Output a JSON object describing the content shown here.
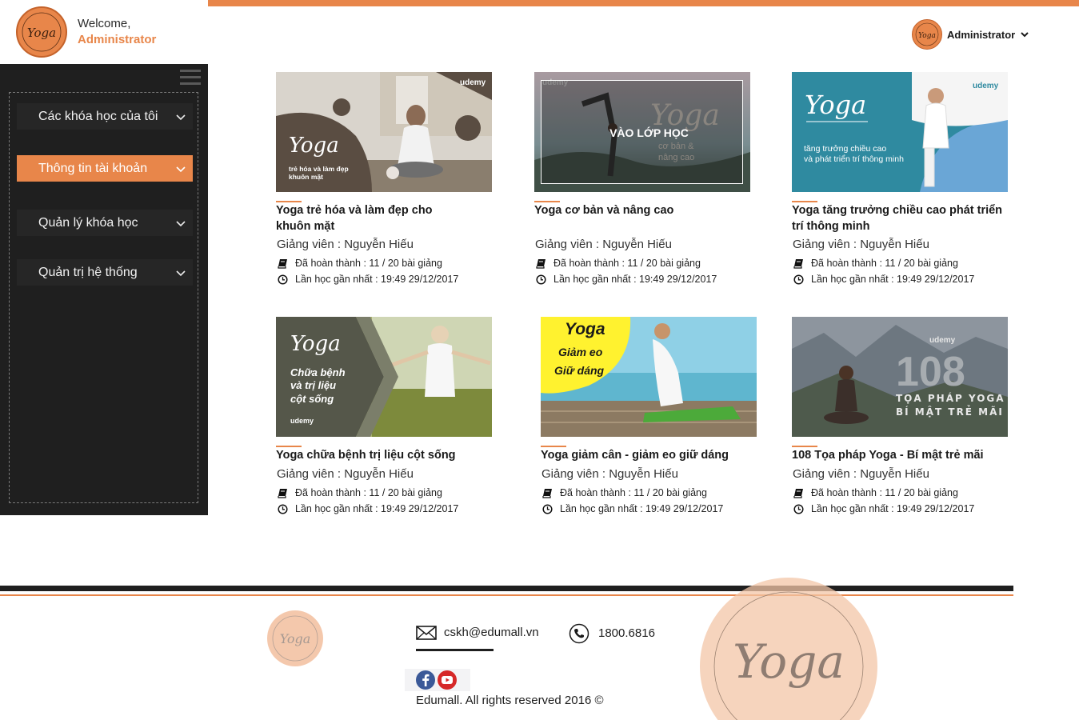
{
  "colors": {
    "accent": "#e8864a",
    "dark": "#1f1f1f",
    "logo_bg": "#f3c6a7"
  },
  "header": {
    "logo_text": "Yoga",
    "welcome": "Welcome,",
    "username": "Administrator",
    "user_menu": {
      "name": "Administrator",
      "caret_icon": "chevron-down-icon"
    }
  },
  "sidebar": {
    "menu_icon": "hamburger-icon",
    "items": [
      {
        "label": "Các khóa học của tôi",
        "active": false
      },
      {
        "label": "Thông tin tài khoản",
        "active": true
      },
      {
        "label": "Quản lý khóa học",
        "active": false
      },
      {
        "label": "Quản trị hệ thống",
        "active": false
      }
    ]
  },
  "courses": [
    {
      "title": "Yoga trẻ hóa và làm đẹp cho khuôn mặt",
      "instructor": "Giảng viên : Nguyễn Hiếu",
      "progress": "Đã hoàn thành : 11 / 20 bài giảng",
      "last_study": "Lần học gần nhất : 19:49 29/12/2017",
      "thumb": {
        "brand": "udemy",
        "heading": "Yoga",
        "sub1": "trẻ hóa và làm đẹp",
        "sub2": "khuôn mặt"
      }
    },
    {
      "title": "Yoga cơ bản và nâng cao",
      "instructor": "Giảng viên : Nguyễn Hiếu",
      "progress": "Đã hoàn thành : 11 / 20 bài giảng",
      "last_study": "Lần học gần nhất : 19:49 29/12/2017",
      "thumb": {
        "brand": "udemy",
        "heading": "Yoga",
        "sub1": "cơ bản &",
        "sub2": "nâng cao",
        "overlay": "VÀO LỚP HỌC"
      }
    },
    {
      "title": "Yoga tăng trưởng chiều cao phát triển trí thông minh",
      "instructor": "Giảng viên : Nguyễn Hiếu",
      "progress": "Đã hoàn thành : 11 / 20 bài giảng",
      "last_study": "Lần học gần nhất : 19:49 29/12/2017",
      "thumb": {
        "brand": "udemy",
        "heading": "Yoga",
        "sub1": "tăng trưởng chiều cao",
        "sub2": "và phát triển trí thông minh"
      }
    },
    {
      "title": "Yoga chữa bệnh trị liệu cột sống",
      "instructor": "Giảng viên : Nguyễn Hiếu",
      "progress": "Đã hoàn thành : 11 / 20 bài giảng",
      "last_study": "Lần học gần nhất : 19:49 29/12/2017",
      "thumb": {
        "brand": "udemy",
        "heading": "Yoga",
        "sub1": "Chữa bệnh",
        "sub2": "và trị liệu",
        "sub3": "cột sống"
      }
    },
    {
      "title": "Yoga giảm cân - giảm eo giữ dáng",
      "instructor": "Giảng viên : Nguyễn Hiếu",
      "progress": "Đã hoàn thành : 11 / 20 bài giảng",
      "last_study": "Lần học gần nhất : 19:49 29/12/2017",
      "thumb": {
        "heading": "Yoga",
        "sub1": "Giảm eo",
        "sub2": "Giữ dáng"
      }
    },
    {
      "title": "108 Tọa pháp Yoga - Bí mật trẻ mãi",
      "instructor": "Giảng viên : Nguyễn Hiếu",
      "progress": "Đã hoàn thành : 11 / 20 bài giảng",
      "last_study": "Lần học gần nhất : 19:49 29/12/2017",
      "thumb": {
        "brand": "udemy",
        "heading": "108",
        "sub1": "TỌA PHÁP YOGA",
        "sub2": "BÍ MẬT TRẺ MÃI"
      }
    }
  ],
  "footer": {
    "logo_text": "Yoga",
    "email": "cskh@edumall.vn",
    "phone": "1800.6816",
    "social": [
      "facebook-icon",
      "youtube-icon"
    ],
    "copyright": "Edumall. All rights reserved 2016 ©",
    "watermark_text": "Yoga"
  }
}
